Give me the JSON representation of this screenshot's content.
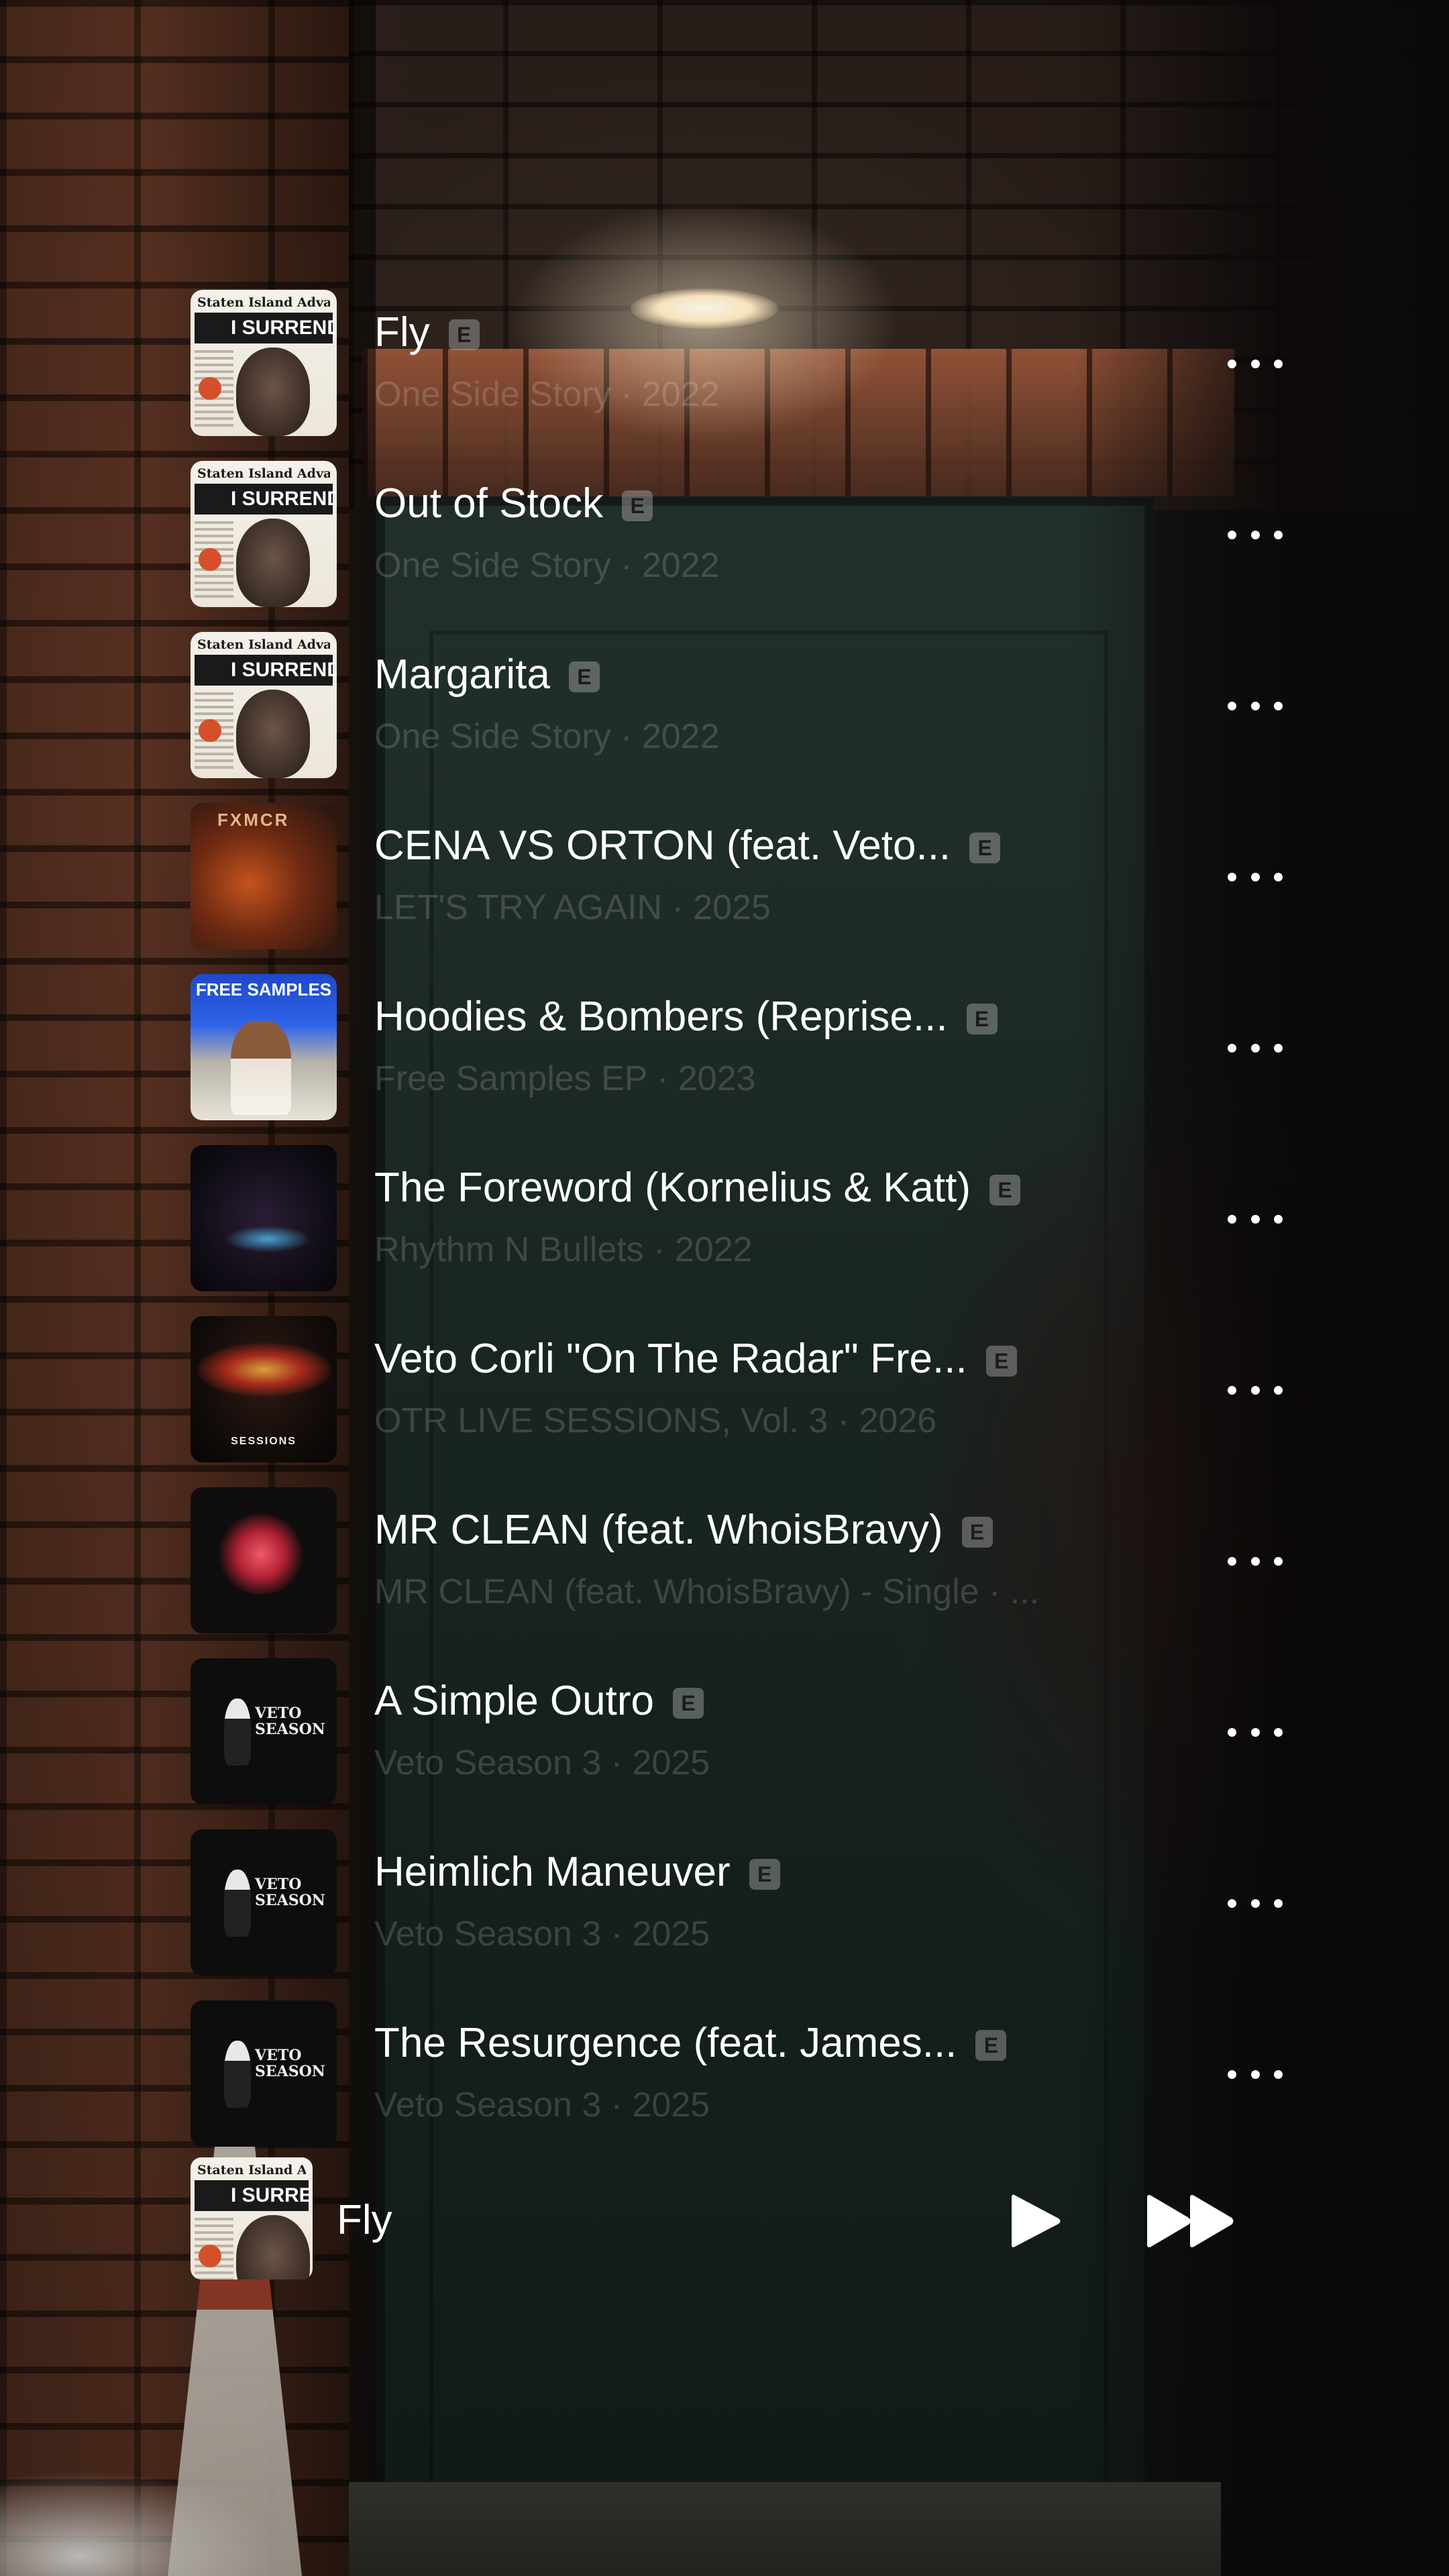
{
  "tracks": [
    {
      "title": "Fly",
      "explicit": "E",
      "subtitle": "One Side Story · 2022",
      "art": "paper"
    },
    {
      "title": "Out of Stock",
      "explicit": "E",
      "subtitle": "One Side Story · 2022",
      "art": "paper"
    },
    {
      "title": "Margarita",
      "explicit": "E",
      "subtitle": "One Side Story · 2022",
      "art": "paper"
    },
    {
      "title": "CENA VS ORTON (feat. Veto...",
      "explicit": "E",
      "subtitle": "LET'S TRY AGAIN · 2025",
      "art": "fxmcr"
    },
    {
      "title": "Hoodies & Bombers (Reprise...",
      "explicit": "E",
      "subtitle": "Free Samples EP · 2023",
      "art": "free"
    },
    {
      "title": "The Foreword (Kornelius & Katt)",
      "explicit": "E",
      "subtitle": "Rhythm N Bullets · 2022",
      "art": "dark"
    },
    {
      "title": "Veto Corli \"On The Radar\" Fre...",
      "explicit": "E",
      "subtitle": "OTR LIVE SESSIONS, Vol. 3 · 2026",
      "art": "sessions"
    },
    {
      "title": "MR CLEAN (feat. WhoisBravy)",
      "explicit": "E",
      "subtitle": "MR CLEAN (feat. WhoisBravy) - Single · ...",
      "art": "clean"
    },
    {
      "title": "A Simple Outro",
      "explicit": "E",
      "subtitle": "Veto Season 3 · 2025",
      "art": "veto"
    },
    {
      "title": "Heimlich Maneuver",
      "explicit": "E",
      "subtitle": "Veto Season 3 · 2025",
      "art": "veto"
    },
    {
      "title": "The Resurgence (feat. James...",
      "explicit": "E",
      "subtitle": "Veto Season 3 · 2025",
      "art": "veto"
    }
  ],
  "artwork_text": {
    "masthead": "Staten Island Advance",
    "headline": "I SURRENDER",
    "fxmcr": "FXMCR",
    "free_samples": "FREE SAMPLES",
    "sessions": "SESSIONS",
    "veto_season": "VETO SEASON"
  },
  "now_playing": {
    "title": "Fly",
    "play_icon": "play-icon",
    "next_icon": "fast-forward-icon"
  },
  "icons": {
    "more": "ellipsis-icon",
    "explicit": "explicit-badge"
  },
  "colors": {
    "text_primary": "#ffffff",
    "text_secondary": "rgba(255,255,255,0.16)"
  }
}
